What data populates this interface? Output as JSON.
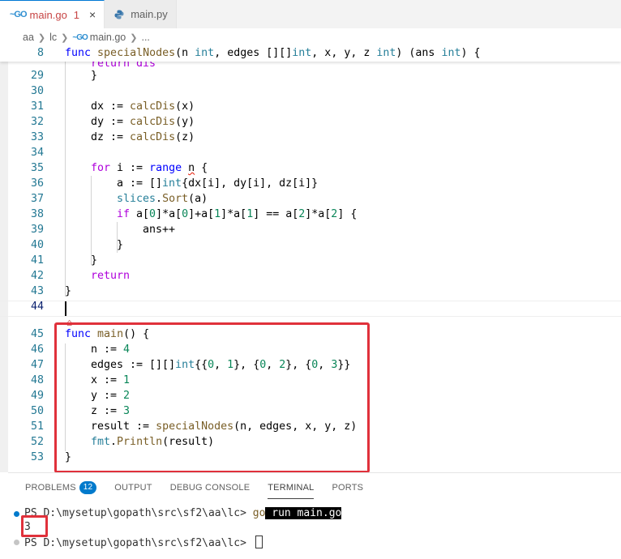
{
  "tabs": [
    {
      "icon": "go-icon",
      "label": "main.go",
      "badge": "1",
      "close": "×",
      "active": true
    },
    {
      "icon": "python-icon",
      "label": "main.py",
      "active": false
    }
  ],
  "breadcrumb": [
    "aa",
    "lc",
    "main.go",
    "..."
  ],
  "editor": {
    "sticky": {
      "line": "8",
      "code": "func specialNodes(n int, edges [][]int, x, y, z int) (ans int) {"
    },
    "lines": [
      {
        "n": "29",
        "code": "}"
      },
      {
        "n": "30",
        "code": ""
      },
      {
        "n": "31",
        "code": "dx := calcDis(x)"
      },
      {
        "n": "32",
        "code": "dy := calcDis(y)"
      },
      {
        "n": "33",
        "code": "dz := calcDis(z)"
      },
      {
        "n": "34",
        "code": ""
      },
      {
        "n": "35",
        "code": "for i := range n {"
      },
      {
        "n": "36",
        "code": "a := []int{dx[i], dy[i], dz[i]}"
      },
      {
        "n": "37",
        "code": "slices.Sort(a)"
      },
      {
        "n": "38",
        "code": "if a[0]*a[0]+a[1]*a[1] == a[2]*a[2] {"
      },
      {
        "n": "39",
        "code": "ans++"
      },
      {
        "n": "40",
        "code": "}"
      },
      {
        "n": "41",
        "code": "}"
      },
      {
        "n": "42",
        "code": "return"
      },
      {
        "n": "43",
        "code": "}"
      },
      {
        "n": "44",
        "code": ""
      },
      {
        "n": "45",
        "code": "func main() {"
      },
      {
        "n": "46",
        "code": "n := 4"
      },
      {
        "n": "47",
        "code": "edges := [][]int{{0, 1}, {0, 2}, {0, 3}}"
      },
      {
        "n": "48",
        "code": "x := 1"
      },
      {
        "n": "49",
        "code": "y := 2"
      },
      {
        "n": "50",
        "code": "z := 3"
      },
      {
        "n": "51",
        "code": "result := specialNodes(n, edges, x, y, z)"
      },
      {
        "n": "52",
        "code": "fmt.Println(result)"
      },
      {
        "n": "53",
        "code": "}"
      }
    ]
  },
  "panel": {
    "tabs": [
      {
        "label": "PROBLEMS",
        "badge": "12"
      },
      {
        "label": "OUTPUT"
      },
      {
        "label": "DEBUG CONSOLE"
      },
      {
        "label": "TERMINAL",
        "active": true
      },
      {
        "label": "PORTS"
      }
    ]
  },
  "terminal": {
    "prompt1": "PS D:\\mysetup\\gopath\\src\\sf2\\aa\\lc> ",
    "cmd_go": "go",
    "cmd_rest": " run main.go",
    "output": "3",
    "prompt2": "PS D:\\mysetup\\gopath\\src\\sf2\\aa\\lc> "
  },
  "colors": {
    "accent": "#0078d4",
    "annotation_red": "#e0313b",
    "line_number": "#237893",
    "status_dot": "#007acc"
  }
}
